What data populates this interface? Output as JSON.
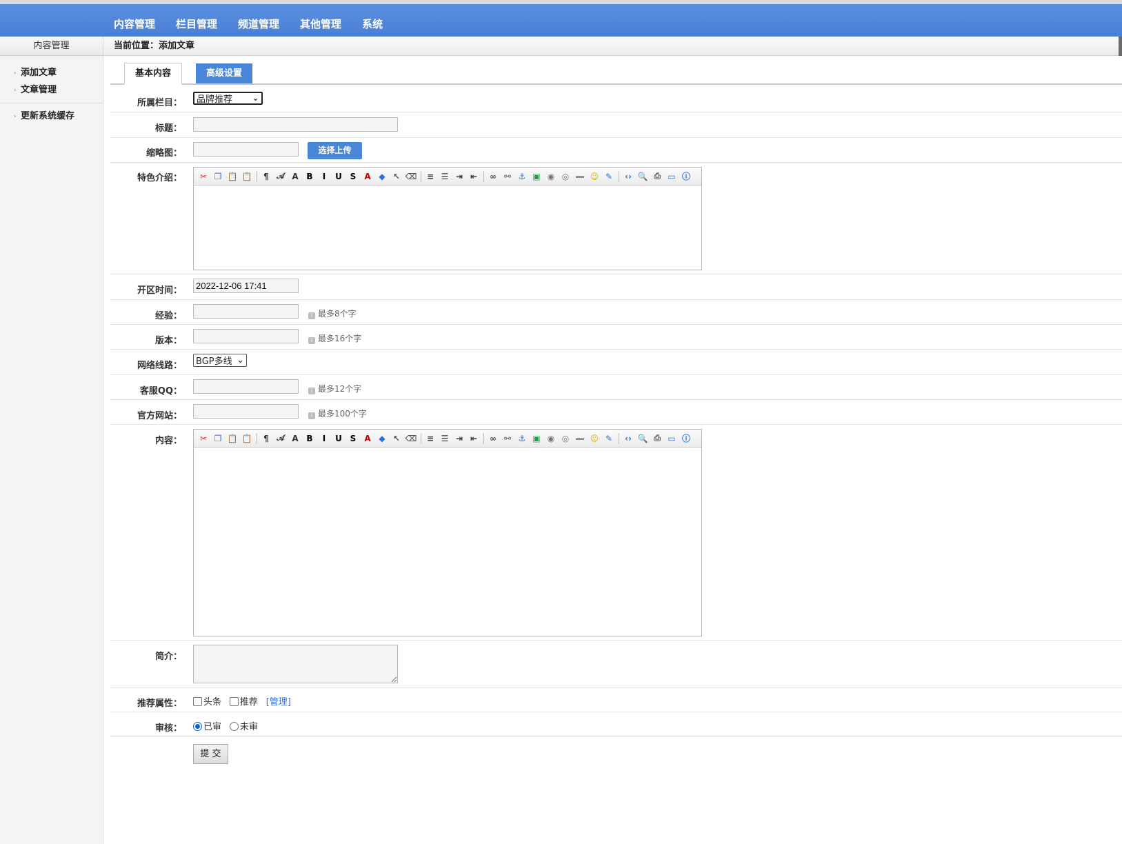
{
  "topnav": [
    "内容管理",
    "栏目管理",
    "频道管理",
    "其他管理",
    "系统"
  ],
  "sidebar": {
    "title": "内容管理",
    "items": [
      "添加文章",
      "文章管理"
    ],
    "extra_items": [
      "更新系统缓存"
    ]
  },
  "breadcrumb": "当前位置：添加文章",
  "tabs": {
    "basic": "基本内容",
    "advanced": "高级设置"
  },
  "form": {
    "category": {
      "label": "所属栏目：",
      "value": "品牌推荐"
    },
    "title": {
      "label": "标题：",
      "value": ""
    },
    "thumbnail": {
      "label": "缩略图：",
      "value": "",
      "upload_button": "选择上传"
    },
    "feature": {
      "label": "特色介绍："
    },
    "open_time": {
      "label": "开区时间：",
      "value": "2022-12-06 17:41"
    },
    "experience": {
      "label": "经验：",
      "value": "",
      "hint": "最多8个字"
    },
    "version": {
      "label": "版本：",
      "value": "",
      "hint": "最多16个字"
    },
    "network": {
      "label": "网络线路：",
      "value": "BGP多线"
    },
    "service_qq": {
      "label": "客服QQ：",
      "value": "",
      "hint": "最多12个字"
    },
    "website": {
      "label": "官方网站：",
      "value": "",
      "hint": "最多100个字"
    },
    "content": {
      "label": "内容："
    },
    "summary": {
      "label": "简介：",
      "value": ""
    },
    "recommend": {
      "label": "推荐属性：",
      "options": [
        "头条",
        "推荐"
      ],
      "manage_link": "[管理]"
    },
    "review": {
      "label": "审核：",
      "options": [
        "已审",
        "未审"
      ],
      "selected": "已审"
    },
    "submit_label": "提 交"
  },
  "editor_toolbar_icons": [
    "cut-icon",
    "copy-icon",
    "paste-icon",
    "paste-text-icon",
    "format-block-icon",
    "font-name-icon",
    "font-size-icon",
    "bold-icon",
    "italic-icon",
    "underline-icon",
    "strikethrough-icon",
    "font-color-icon",
    "bg-color-icon",
    "select-icon",
    "eraser-icon",
    "align-icon",
    "list-icon",
    "indent-icon",
    "outdent-icon",
    "link-icon",
    "unlink-icon",
    "anchor-icon",
    "image-icon",
    "flash-icon",
    "media-icon",
    "hr-icon",
    "emoticon-icon",
    "table-icon",
    "source-code-icon",
    "preview-icon",
    "print-icon",
    "fullscreen-icon",
    "about-icon"
  ],
  "colors": {
    "topbar": "#4a7fd4",
    "accent_button": "#4a86d8",
    "link": "#3a6fc9"
  }
}
